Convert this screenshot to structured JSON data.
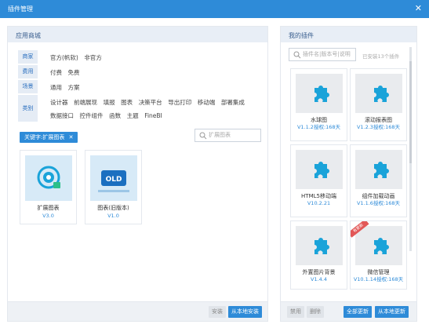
{
  "window": {
    "title": "插件管理",
    "close": "✕"
  },
  "store": {
    "heading": "应用商城",
    "filters": [
      {
        "key": "商家",
        "values": [
          "官方(帆软)",
          "非官方"
        ]
      },
      {
        "key": "费用",
        "values": [
          "付费",
          "免费"
        ]
      },
      {
        "key": "场景",
        "values": [
          "通用",
          "方案"
        ]
      },
      {
        "key": "类别",
        "values": [
          "设计器",
          "前端展现",
          "填报",
          "图表",
          "决策平台",
          "导出打印",
          "移动端",
          "部署集成",
          "数据接口",
          "控件组件",
          "函数",
          "主题",
          "FineBI"
        ]
      }
    ],
    "keyword_tag": "关键字:扩展图表",
    "keyword_close": "✕",
    "search_placeholder": "扩展图表",
    "plugins": [
      {
        "name": "扩展图表",
        "version": "V3.0",
        "icon": "chart-badge-icon"
      },
      {
        "name": "图表(旧版本)",
        "version": "V1.0",
        "icon": "old-chart-icon"
      }
    ],
    "install_label": "安装",
    "install_local_label": "从本地安装"
  },
  "mine": {
    "heading": "我的插件",
    "search_placeholder": "插件名|版本号|说明",
    "installed_count": "已安装13个插件",
    "plugins": [
      {
        "name": "水球图",
        "version": "V1.1.2授权:168天"
      },
      {
        "name": "滚动报表图",
        "version": "V1.2.3授权:168天"
      },
      {
        "name": "HTML5移动端",
        "version": "V10.2.21"
      },
      {
        "name": "组件加载动画",
        "version": "V1.1.6授权:168天"
      },
      {
        "name": "外置图片背景",
        "version": "V1.4.4"
      },
      {
        "name": "微信管理",
        "version": "V10.1.14授权:168天",
        "ribbon": "有更新"
      }
    ],
    "disable_label": "禁用",
    "delete_label": "删除",
    "update_all_label": "全部更新",
    "update_local_label": "从本地更新"
  },
  "colors": {
    "accent": "#2e8bd8",
    "header_bg": "#e8eef6",
    "plugin_icon": "#1aa3d9",
    "ribbon": "#e25757"
  }
}
